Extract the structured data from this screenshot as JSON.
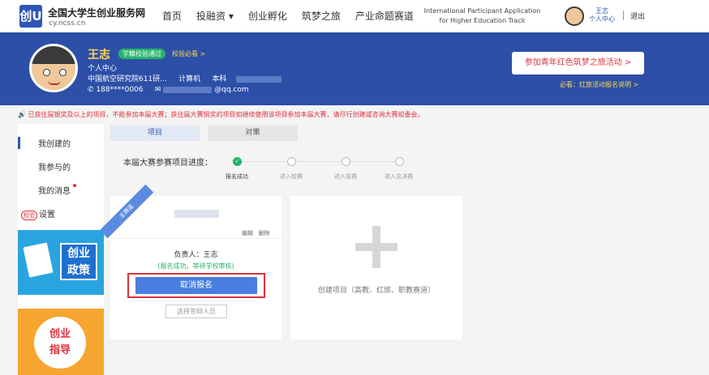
{
  "header": {
    "logo_mark": "创U",
    "site_title": "全国大学生创业服务网",
    "site_domain": "cy.ncss.cn",
    "nav": [
      {
        "label": "首页"
      },
      {
        "label": "投融资 ▾"
      },
      {
        "label": "创业孵化"
      },
      {
        "label": "筑梦之旅"
      },
      {
        "label": "产业命题赛道"
      }
    ],
    "intl_line1": "International Participant Application",
    "intl_line2": "for Higher Education Track",
    "user_name": "王志",
    "user_center": "个人中心",
    "logout": "退出"
  },
  "profile": {
    "name": "王志",
    "verified_badge": "学籍校验通过",
    "verify_link": "校验必看 >",
    "center_label": "个人中心",
    "school": "中国航空研究院611研...",
    "major": "计算机",
    "degree": "本科",
    "phone": "188****0006",
    "email_suffix": "@qq.com",
    "cta_label": "参加青年红色筑梦之旅活动  >",
    "cta_sub": "必看：红旅活动报名说明 >"
  },
  "notice": "已获往届银奖及以上的项目，不能参加本届大赛；获往届大赛铜奖的项目如继续使用该项目参加本届大赛，请尽行创建或咨询大赛组委会。",
  "sidebar": {
    "items": [
      {
        "label": "我创建的"
      },
      {
        "label": "我参与的"
      },
      {
        "label": "我的消息"
      },
      {
        "label": "设置",
        "tag": "校验"
      }
    ],
    "promo1": "创业政策",
    "promo1_line1": "创业",
    "promo1_line2": "政策",
    "promo2_line1": "创业",
    "promo2_line2": "指导"
  },
  "tabs": [
    {
      "label": "项目"
    },
    {
      "label": "对策"
    }
  ],
  "progress": {
    "label": "本届大赛参赛项目进度：",
    "steps": [
      {
        "label": "报名成功",
        "done": true
      },
      {
        "label": "进入校赛",
        "done": false
      },
      {
        "label": "进入省赛",
        "done": false
      },
      {
        "label": "进入总决赛",
        "done": false
      }
    ]
  },
  "project_card": {
    "ribbon": "主赛道",
    "action_edit": "编辑",
    "action_delete": "删除",
    "owner": "负责人：王志",
    "status": "(报名成功，等待学校审核)",
    "cancel_label": "取消报名",
    "reviewer_label": "选择答辩人员"
  },
  "create_card": {
    "label": "创建项目（高教、红旅、职教赛道）"
  },
  "colors": {
    "brand": "#2f56b7",
    "banner": "#2d4fa8",
    "alert": "#e0303a",
    "success": "#26b36b"
  }
}
